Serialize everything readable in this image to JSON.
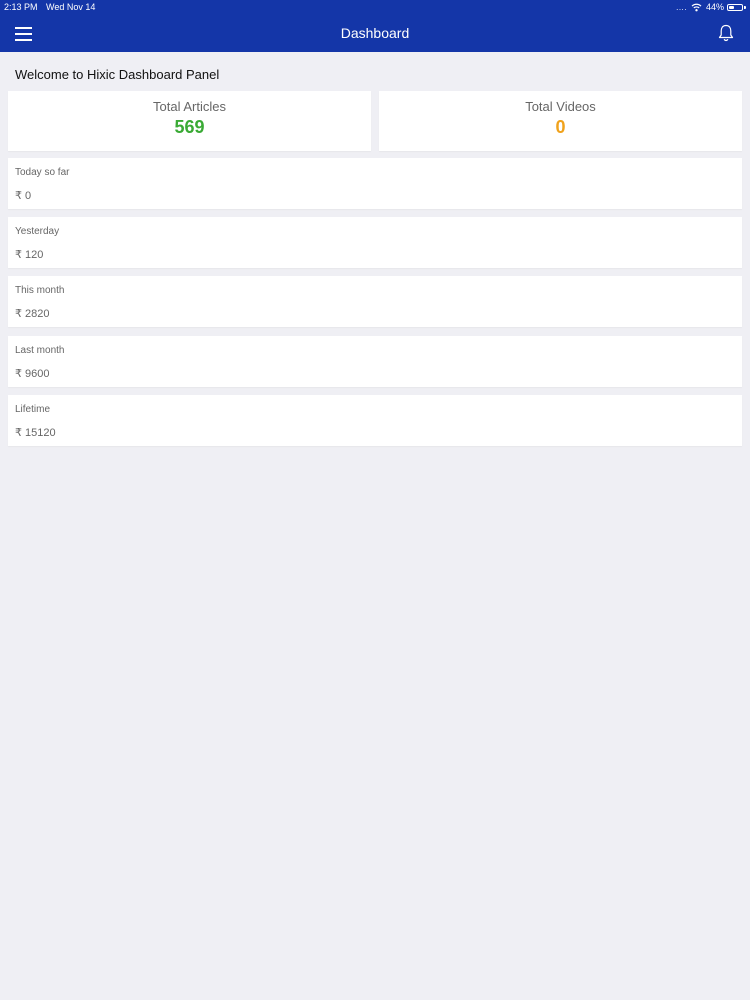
{
  "status_bar": {
    "time": "2:13 PM",
    "date": "Wed Nov 14",
    "signal": "....",
    "battery_percent": "44%",
    "battery_level": 0.44
  },
  "header": {
    "title": "Dashboard",
    "menu_icon": "hamburger-menu-icon",
    "bell_icon": "bell-icon",
    "background_color": "#1436a8"
  },
  "welcome_text": "Welcome to Hixic Dashboard Panel",
  "totals": {
    "articles": {
      "label": "Total Articles",
      "value": "569",
      "color": "#3aaa35"
    },
    "videos": {
      "label": "Total Videos",
      "value": "0",
      "color": "#f0a21c"
    }
  },
  "stats": [
    {
      "label": "Today so far",
      "value": "₹ 0"
    },
    {
      "label": "Yesterday",
      "value": "₹ 120"
    },
    {
      "label": "This month",
      "value": "₹ 2820"
    },
    {
      "label": "Last month",
      "value": "₹ 9600"
    },
    {
      "label": "Lifetime",
      "value": "₹ 15120"
    }
  ]
}
